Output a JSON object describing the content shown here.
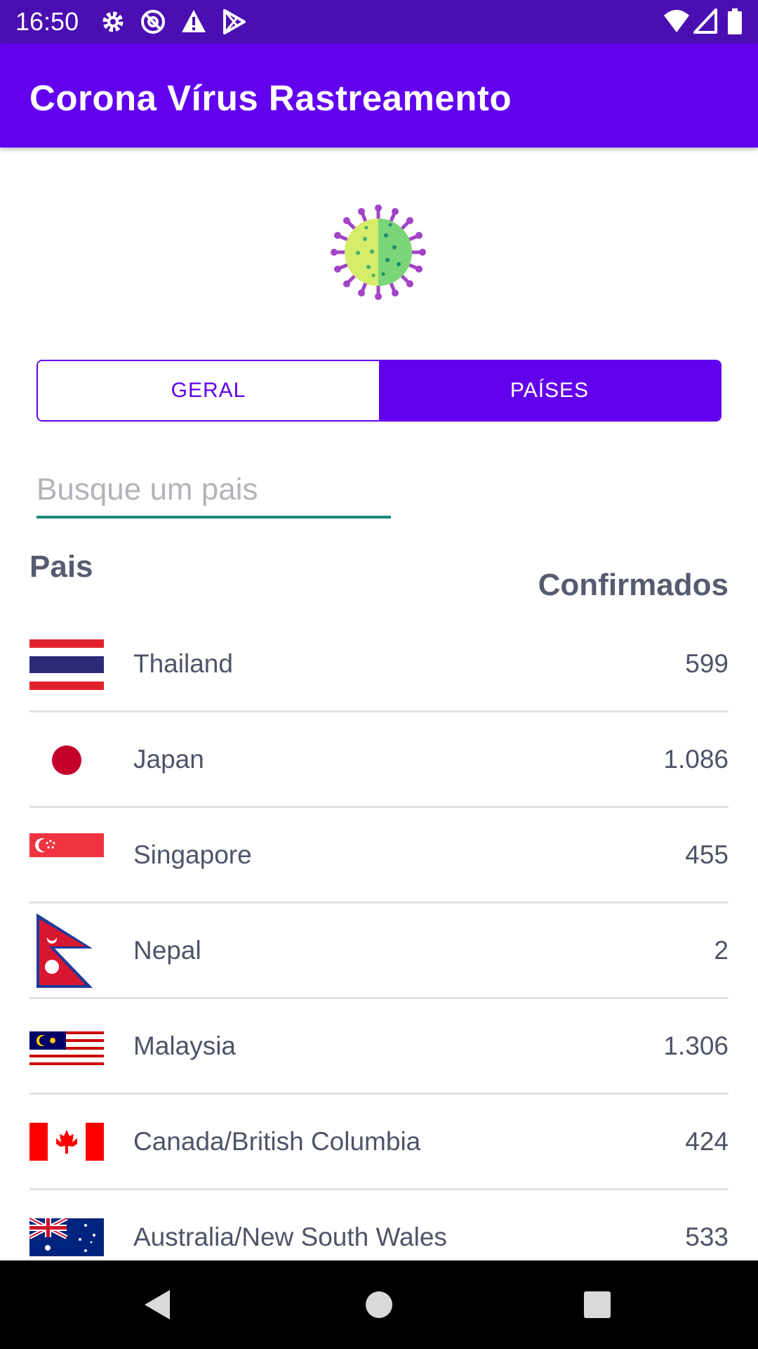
{
  "status_bar": {
    "time": "16:50",
    "icons": [
      "gear-icon",
      "at-sign-icon",
      "warning-icon",
      "play-store-icon",
      "wifi-icon",
      "signal-icon",
      "battery-icon"
    ]
  },
  "app_bar": {
    "title": "Corona Vírus Rastreamento",
    "color": "#6200ee"
  },
  "logo": {
    "icon": "virus-icon"
  },
  "segmented": {
    "geral_label": "GERAL",
    "paises_label": "PAÍSES",
    "selected": "PAÍSES"
  },
  "search": {
    "placeholder": "Busque um pais",
    "value": ""
  },
  "headers": {
    "country": "Pais",
    "confirmed": "Confirmados"
  },
  "rows": [
    {
      "flag": "thailand-flag-icon",
      "name": "Thailand",
      "confirmed": "599"
    },
    {
      "flag": "japan-flag-icon",
      "name": "Japan",
      "confirmed": "1.086"
    },
    {
      "flag": "singapore-flag-icon",
      "name": "Singapore",
      "confirmed": "455"
    },
    {
      "flag": "nepal-flag-icon",
      "name": "Nepal",
      "confirmed": "2"
    },
    {
      "flag": "malaysia-flag-icon",
      "name": "Malaysia",
      "confirmed": "1.306"
    },
    {
      "flag": "canada-flag-icon",
      "name": "Canada/British Columbia",
      "confirmed": "424"
    },
    {
      "flag": "australia-flag-icon",
      "name": "Australia/New South Wales",
      "confirmed": "533"
    }
  ],
  "nav_bar": {
    "icons": [
      "back-icon",
      "home-icon",
      "recents-icon"
    ]
  }
}
